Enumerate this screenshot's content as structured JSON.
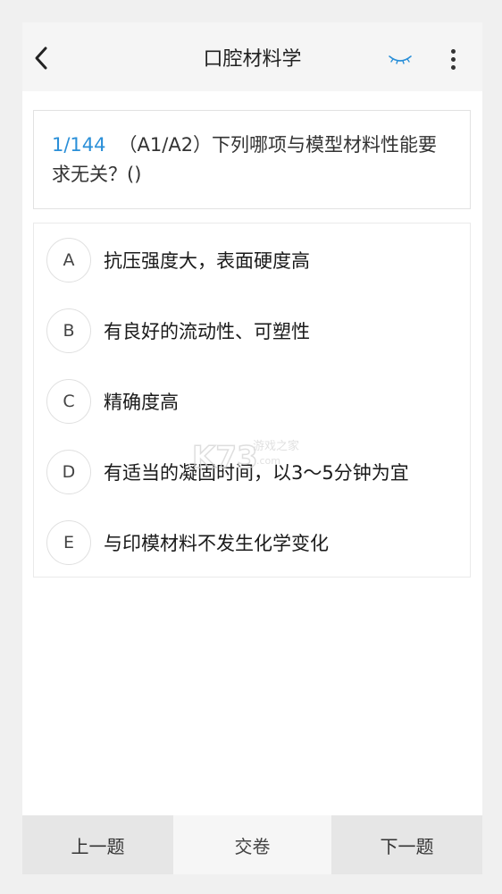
{
  "header": {
    "title": "口腔材料学",
    "back_icon": "chevron-left-icon",
    "eye_icon": "eye-closed-icon",
    "more_icon": "more-vertical-icon",
    "accent_color": "#2a8fd8"
  },
  "question": {
    "index": "1/144",
    "text": "（A1/A2）下列哪项与模型材料性能要求无关？()"
  },
  "options": [
    {
      "letter": "A",
      "text": "抗压强度大，表面硬度高"
    },
    {
      "letter": "B",
      "text": "有良好的流动性、可塑性"
    },
    {
      "letter": "C",
      "text": "精确度高"
    },
    {
      "letter": "D",
      "text": "有适当的凝固时间，以3～5分钟为宜"
    },
    {
      "letter": "E",
      "text": "与印模材料不发生化学变化"
    }
  ],
  "watermark": {
    "brand": "K73",
    "sub": "游戏之家",
    "domain": ".com"
  },
  "footer": {
    "prev_label": "上一题",
    "submit_label": "交卷",
    "next_label": "下一题"
  }
}
